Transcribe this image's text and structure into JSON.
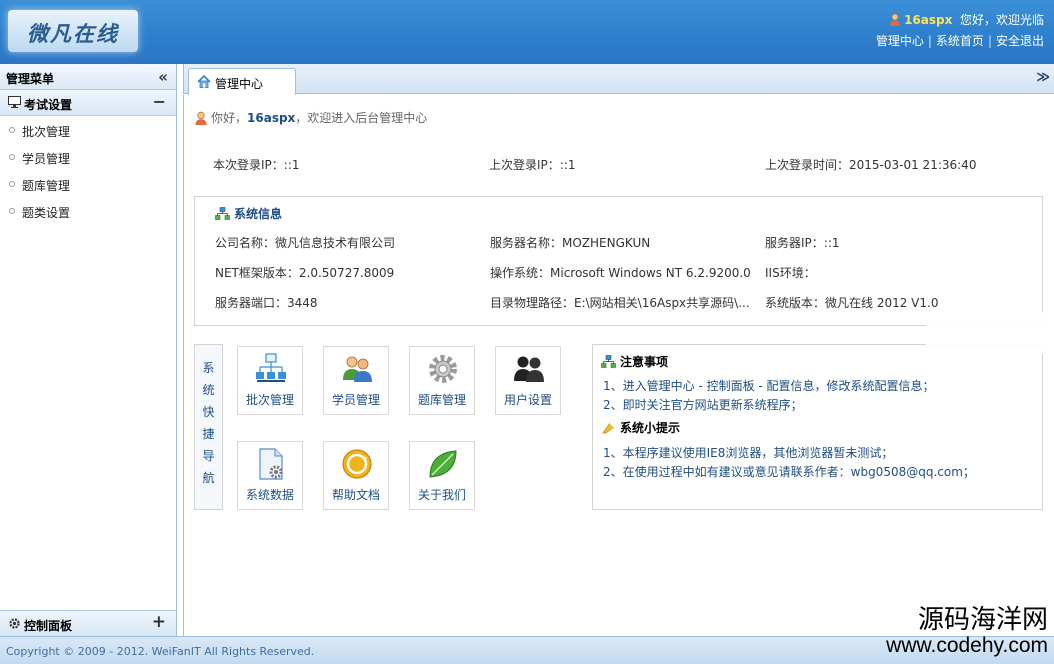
{
  "header": {
    "logo_text": "微凡在线",
    "username": "16aspx",
    "greeting": "您好，欢迎光临",
    "links": [
      "管理中心",
      "系统首页",
      "安全退出"
    ]
  },
  "sidebar": {
    "title": "管理菜单",
    "collapse_icon": "«",
    "group": {
      "label": "考试设置",
      "toggle": "−"
    },
    "items": [
      {
        "label": "批次管理"
      },
      {
        "label": "学员管理"
      },
      {
        "label": "题库管理"
      },
      {
        "label": "题类设置"
      }
    ],
    "bottom": {
      "label": "控制面板",
      "toggle": "+"
    }
  },
  "tabs": [
    {
      "label": "管理中心"
    }
  ],
  "tab_menu_icon": "≫",
  "main": {
    "welcome": {
      "prefix": "你好，",
      "username": "16aspx",
      "suffix": "，欢迎进入后台管理中心"
    },
    "login": {
      "this_ip": "本次登录IP：::1",
      "last_ip": "上次登录IP：::1",
      "last_time": "上次登录时间：2015-03-01 21:36:40"
    },
    "sysinfo": {
      "title": "系统信息",
      "company": "公司名称：微凡信息技术有限公司",
      "server_name": "服务器名称：MOZHENGKUN",
      "server_ip": "服务器IP：::1",
      "net_version": "NET框架版本：2.0.50727.8009",
      "os": "操作系统：Microsoft Windows NT 6.2.9200.0",
      "iis": "IIS环境：",
      "port": "服务器端口：3448",
      "path": "目录物理路径：E:\\网站相关\\16Aspx共享源码\\...",
      "version": "系统版本：微凡在线 2012 V1.0"
    },
    "quicknav": {
      "title_chars": [
        "系",
        "统",
        "快",
        "捷",
        "导",
        "航"
      ],
      "buttons": [
        {
          "label": "批次管理",
          "icon": "org-chart-icon"
        },
        {
          "label": "学员管理",
          "icon": "users-icon"
        },
        {
          "label": "题库管理",
          "icon": "gear-icon"
        },
        {
          "label": "用户设置",
          "icon": "user-group-icon"
        },
        {
          "label": "系统数据",
          "icon": "document-gear-icon"
        },
        {
          "label": "帮助文档",
          "icon": "help-refresh-icon"
        },
        {
          "label": "关于我们",
          "icon": "leaf-icon"
        }
      ]
    },
    "notice": {
      "title": "注意事项",
      "items": [
        "1、进入管理中心 - 控制面板 - 配置信息，修改系统配置信息；",
        "2、即时关注官方网站更新系统程序；"
      ],
      "tips_title": "系统小提示",
      "tips": [
        "1、本程序建议使用IE8浏览器，其他浏览器暂未测试；",
        "2、在使用过程中如有建议或意见请联系作者：wbg0508@qq.com；"
      ]
    }
  },
  "footer": {
    "copyright": "Copyright © 2009 - 2012. WeiFanIT All Rights Reserved."
  },
  "watermark": {
    "line1": "源码海洋网",
    "line2": "www.codehy.com"
  },
  "colors": {
    "header_blue": "#2f80cd",
    "link_blue": "#1f4d86",
    "username_yellow": "#ffe45c"
  }
}
